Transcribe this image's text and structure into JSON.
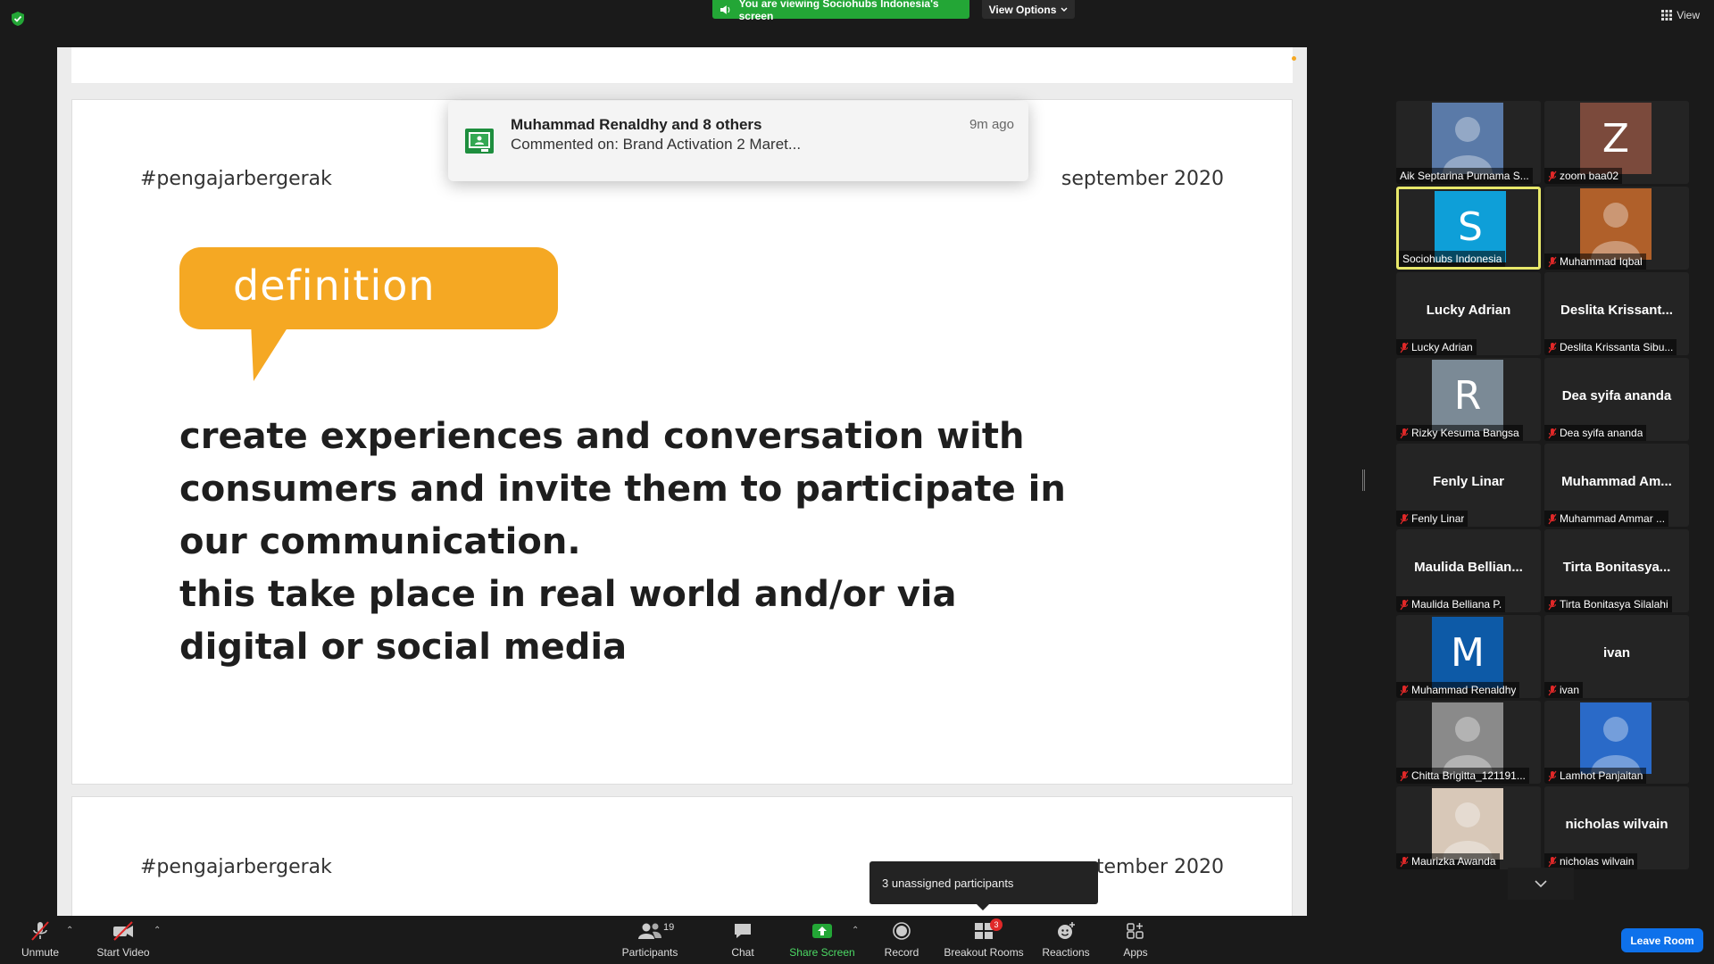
{
  "top": {
    "share_banner": "You are viewing Sociohubs Indonesia's screen",
    "view_options": "View Options",
    "view": "View"
  },
  "notification": {
    "title": "Muhammad Renaldhy and 8 others",
    "subtitle": "Commented on: Brand Activation 2 Maret...",
    "time": "9m ago"
  },
  "slide": {
    "hashtag": "#pengajarbergerak",
    "date": "september 2020",
    "bubble": "definition",
    "lines": [
      "create experiences and conversation with",
      "consumers and invite them to participate in",
      "our communication.",
      "this take place in real world and/or via",
      "digital or social media"
    ],
    "next_hashtag": "#pengajarbergerak",
    "next_date": "tember 2020"
  },
  "tooltip": "3 unassigned participants",
  "participants": [
    {
      "name": "Aik Septarina Purnama S...",
      "muted": false,
      "type": "photo",
      "color": "#5a7aa8"
    },
    {
      "name": "zoom baa02",
      "muted": true,
      "type": "letter",
      "letter": "Z",
      "color": "#7b4a3c"
    },
    {
      "name": "Sociohubs Indonesia",
      "muted": false,
      "type": "letter",
      "letter": "S",
      "color": "#0e9fd8",
      "active": true
    },
    {
      "name": "Muhammad Iqbal",
      "muted": true,
      "type": "photo",
      "color": "#b0602a"
    },
    {
      "name": "Lucky Adrian",
      "muted": true,
      "type": "name",
      "bigname": "Lucky Adrian"
    },
    {
      "name": "Deslita Krissanta Sibu...",
      "muted": true,
      "type": "name",
      "bigname": "Deslita Krissant..."
    },
    {
      "name": "Rizky Kesuma Bangsa",
      "muted": true,
      "type": "letter",
      "letter": "R",
      "color": "#7b8a96"
    },
    {
      "name": "Dea syifa ananda",
      "muted": true,
      "type": "name",
      "bigname": "Dea syifa ananda"
    },
    {
      "name": "Fenly Linar",
      "muted": true,
      "type": "name",
      "bigname": "Fenly Linar"
    },
    {
      "name": "Muhammad Ammar ...",
      "muted": true,
      "type": "name",
      "bigname": "Muhammad Am..."
    },
    {
      "name": "Maulida Belliana P.",
      "muted": true,
      "type": "name",
      "bigname": "Maulida Bellian..."
    },
    {
      "name": "Tirta Bonitasya Silalahi",
      "muted": true,
      "type": "name",
      "bigname": "Tirta Bonitasya..."
    },
    {
      "name": "Muhammad Renaldhy",
      "muted": true,
      "type": "letter",
      "letter": "M",
      "color": "#0d5aa7"
    },
    {
      "name": "ivan",
      "muted": true,
      "type": "name",
      "bigname": "ivan"
    },
    {
      "name": "Chitta Brigitta_121191...",
      "muted": true,
      "type": "photo",
      "color": "#8a8a8a"
    },
    {
      "name": "Lamhot Panjaitan",
      "muted": true,
      "type": "photo",
      "color": "#2a6ac8"
    },
    {
      "name": "Maurizka Awanda",
      "muted": true,
      "type": "photo",
      "color": "#d8c8b8"
    },
    {
      "name": "nicholas wilvain",
      "muted": true,
      "type": "name",
      "bigname": "nicholas wilvain"
    }
  ],
  "toolbar": {
    "unmute": "Unmute",
    "start_video": "Start Video",
    "participants": "Participants",
    "participants_count": "19",
    "chat": "Chat",
    "share_screen": "Share Screen",
    "record": "Record",
    "breakout_rooms": "Breakout Rooms",
    "breakout_badge": "3",
    "reactions": "Reactions",
    "apps": "Apps",
    "leave_room": "Leave Room"
  }
}
